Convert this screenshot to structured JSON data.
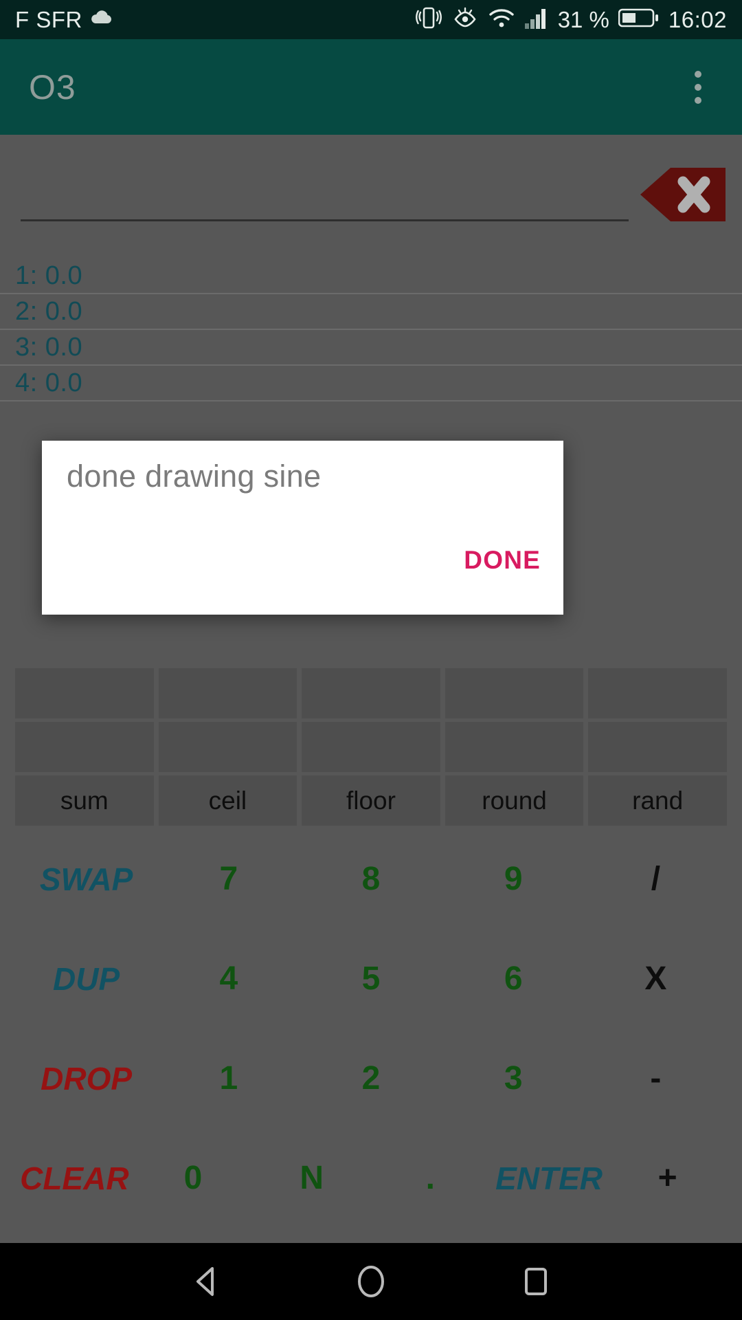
{
  "status_bar": {
    "carrier": "F SFR",
    "battery_percent": "31 %",
    "clock": "16:02",
    "icons": [
      "cloud-icon",
      "vibrate-icon",
      "eye-comfort-icon",
      "wifi-icon",
      "signal-icon",
      "battery-icon"
    ]
  },
  "app_bar": {
    "title": "O3",
    "overflow_label": "overflow-menu"
  },
  "entry": {
    "value": "",
    "backspace_label": "backspace"
  },
  "stack": {
    "rows": [
      {
        "label": "1: 0.0"
      },
      {
        "label": "2: 0.0"
      },
      {
        "label": "3: 0.0"
      },
      {
        "label": "4: 0.0"
      }
    ]
  },
  "keypad": {
    "function_rows": [
      {
        "keys": [
          "",
          "",
          "",
          "",
          ""
        ]
      },
      {
        "keys": [
          "",
          "",
          "",
          "",
          ""
        ]
      },
      {
        "keys": [
          "sum",
          "ceil",
          "floor",
          "round",
          "rand"
        ]
      }
    ],
    "pad_rows": [
      {
        "keys": [
          {
            "label": "SWAP",
            "style": "cmd-blue"
          },
          {
            "label": "7",
            "style": "num"
          },
          {
            "label": "8",
            "style": "num"
          },
          {
            "label": "9",
            "style": "num"
          },
          {
            "label": "/",
            "style": "op"
          }
        ]
      },
      {
        "keys": [
          {
            "label": "DUP",
            "style": "cmd-blue"
          },
          {
            "label": "4",
            "style": "num"
          },
          {
            "label": "5",
            "style": "num"
          },
          {
            "label": "6",
            "style": "num"
          },
          {
            "label": "X",
            "style": "op"
          }
        ]
      },
      {
        "keys": [
          {
            "label": "DROP",
            "style": "cmd-red"
          },
          {
            "label": "1",
            "style": "num"
          },
          {
            "label": "2",
            "style": "num"
          },
          {
            "label": "3",
            "style": "num"
          },
          {
            "label": "-",
            "style": "op"
          }
        ]
      },
      {
        "keys": [
          {
            "label": "CLEAR",
            "style": "cmd-red"
          },
          {
            "label": "0",
            "style": "num"
          },
          {
            "label": "N",
            "style": "num"
          },
          {
            "label": ".",
            "style": "dot"
          },
          {
            "label": "ENTER",
            "style": "cmd-blue"
          },
          {
            "label": "+",
            "style": "op"
          }
        ]
      }
    ]
  },
  "dialog": {
    "message": "done drawing sine",
    "done_label": "DONE"
  },
  "nav_bar": {
    "back_label": "back",
    "home_label": "home",
    "recents_label": "recents"
  },
  "colors": {
    "appbar": "#064a42",
    "statusbar": "#04231f",
    "surface": "#707070",
    "accent_pink": "#d81b60",
    "stack_teal": "#16606f",
    "num_green": "#156b16",
    "cmd_red": "#c01818",
    "backspace_red": "#7a1410"
  }
}
